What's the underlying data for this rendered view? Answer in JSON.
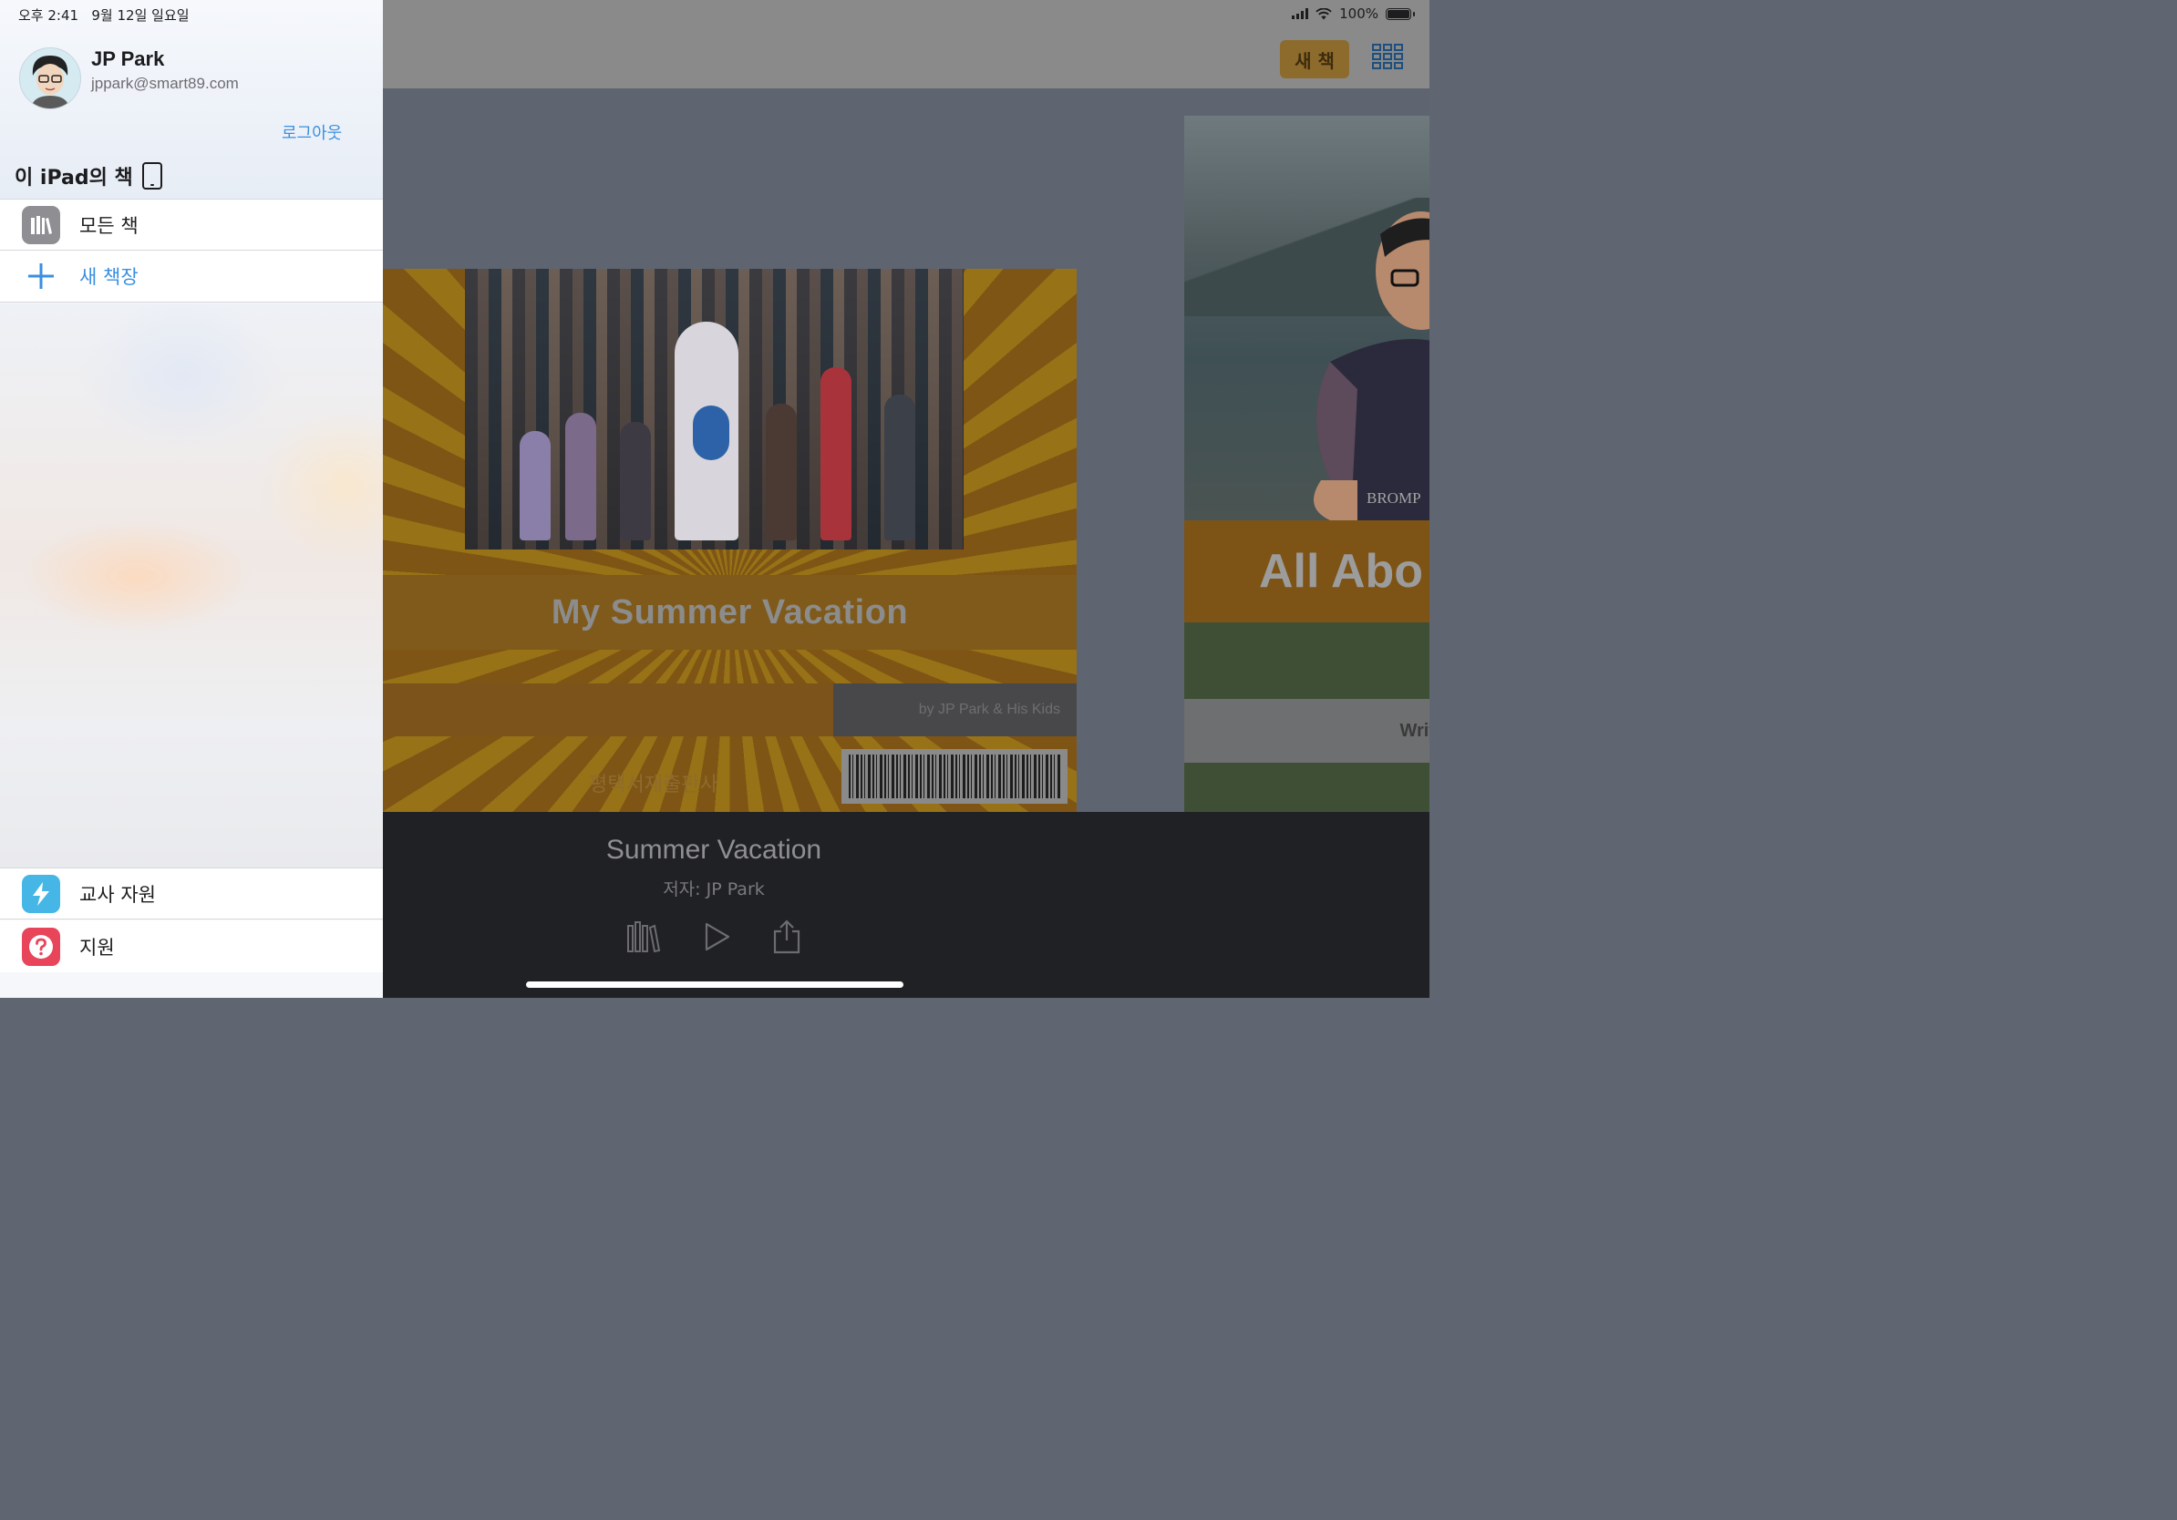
{
  "status_bar": {
    "time": "오후 2:41",
    "date": "9월 12일 일요일",
    "battery": "100%"
  },
  "toolbar": {
    "new_book_label": "새 책",
    "grid_icon": "grid-view-icon"
  },
  "sidebar": {
    "user_name": "JP Park",
    "user_email": "jppark@smart89.com",
    "logout_label": "로그아웃",
    "section_title": "이 iPad의 책",
    "items": [
      {
        "label": "모든 책",
        "icon": "library-icon"
      },
      {
        "label": "새 책장",
        "icon": "plus-icon"
      }
    ],
    "bottom_items": [
      {
        "label": "교사 자원",
        "icon": "lightning-icon"
      },
      {
        "label": "지원",
        "icon": "question-icon"
      }
    ]
  },
  "books": [
    {
      "cover_title": "My Summer Vacation",
      "cover_author": "by JP Park & His Kids",
      "cover_publisher": "평택서재출판사"
    },
    {
      "cover_title": "All Abo",
      "cover_subtitle": "Writ",
      "cover_brand": "BROMP"
    }
  ],
  "selected_book": {
    "title": "Summer Vacation",
    "author": "저자: JP Park"
  },
  "colors": {
    "accent": "#3b8fe0",
    "new_book_btn": "#8d6b2c",
    "cover_orange": "#7f5a1a"
  }
}
